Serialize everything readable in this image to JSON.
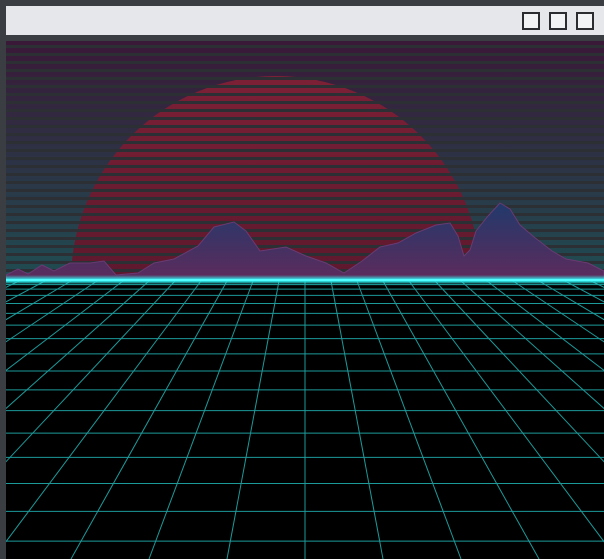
{
  "window": {
    "title": "",
    "buttons": [
      {
        "name": "minimize",
        "icon": "square-icon"
      },
      {
        "name": "maximize",
        "icon": "square-icon"
      },
      {
        "name": "close",
        "icon": "square-icon"
      }
    ]
  },
  "scene": {
    "description_colors": {
      "sky_top": "#3a1838",
      "sky_bottom": "#1f4b4f",
      "sun_top": "#7a1e35",
      "sun_bottom": "#3a0d22",
      "mountain_top": "#243a6a",
      "mountain_bottom": "#5a2a5a",
      "horizon_glow": "#2ff0f0",
      "grid_line": "#1fa0a0",
      "floor": "#000000",
      "stripe": "#2c2f33"
    }
  }
}
